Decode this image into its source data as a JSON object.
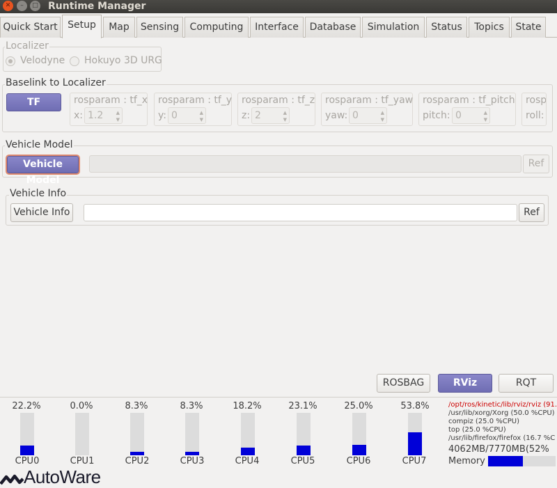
{
  "window": {
    "title": "Runtime Manager"
  },
  "tabs": [
    {
      "label": "Quick Start"
    },
    {
      "label": "Setup"
    },
    {
      "label": "Map"
    },
    {
      "label": "Sensing"
    },
    {
      "label": "Computing"
    },
    {
      "label": "Interface"
    },
    {
      "label": "Database"
    },
    {
      "label": "Simulation"
    },
    {
      "label": "Status"
    },
    {
      "label": "Topics"
    },
    {
      "label": "State"
    }
  ],
  "localizer": {
    "legend": "Localizer",
    "options": [
      "Velodyne",
      "Hokuyo 3D URG"
    ]
  },
  "baselink": {
    "legend": "Baselink to Localizer",
    "tf_button": "TF",
    "params": [
      {
        "caption": "rosparam : tf_x",
        "label": "x:",
        "value": "1.2"
      },
      {
        "caption": "rosparam : tf_y",
        "label": "y:",
        "value": "0"
      },
      {
        "caption": "rosparam : tf_z",
        "label": "z:",
        "value": "2"
      },
      {
        "caption": "rosparam : tf_yaw",
        "label": "yaw:",
        "value": "0"
      },
      {
        "caption": "rosparam : tf_pitch",
        "label": "pitch:",
        "value": "0"
      },
      {
        "caption": "rosp",
        "label": "roll:",
        "value": ""
      }
    ]
  },
  "vehicle_model": {
    "legend": "Vehicle Model",
    "button": "Vehicle Model",
    "path": "",
    "ref": "Ref"
  },
  "vehicle_info": {
    "legend": "Vehicle Info",
    "button": "Vehicle Info",
    "path": "",
    "ref": "Ref"
  },
  "toolbar": {
    "rosbag": "ROSBAG",
    "rviz": "RViz",
    "rqt": "RQT"
  },
  "cpus": [
    {
      "name": "CPU0",
      "percent": "22.2%",
      "level": 0.222
    },
    {
      "name": "CPU1",
      "percent": "0.0%",
      "level": 0.0
    },
    {
      "name": "CPU2",
      "percent": "8.3%",
      "level": 0.083
    },
    {
      "name": "CPU3",
      "percent": "8.3%",
      "level": 0.083
    },
    {
      "name": "CPU4",
      "percent": "18.2%",
      "level": 0.182
    },
    {
      "name": "CPU5",
      "percent": "23.1%",
      "level": 0.231
    },
    {
      "name": "CPU6",
      "percent": "25.0%",
      "level": 0.25
    },
    {
      "name": "CPU7",
      "percent": "53.8%",
      "level": 0.538
    }
  ],
  "processes": [
    {
      "text": "/opt/ros/kinetic/lib/rviz/rviz (91.",
      "color": "#cc0000"
    },
    {
      "text": "/usr/lib/xorg/Xorg (50.0 %CPU)",
      "color": "#3c3c3c"
    },
    {
      "text": "compiz (25.0 %CPU)",
      "color": "#3c3c3c"
    },
    {
      "text": "top (25.0 %CPU)",
      "color": "#3c3c3c"
    },
    {
      "text": "/usr/lib/firefox/firefox (16.7 %C",
      "color": "#3c3c3c"
    }
  ],
  "memory": {
    "summary": "4062MB/7770MB(52%",
    "label": "Memory",
    "level": 0.52
  },
  "logo": {
    "text": "AutoWare"
  },
  "colors": {
    "accent": "#7572bd",
    "cpu_bar": "#0000d8",
    "highlight": "#cc0000"
  }
}
